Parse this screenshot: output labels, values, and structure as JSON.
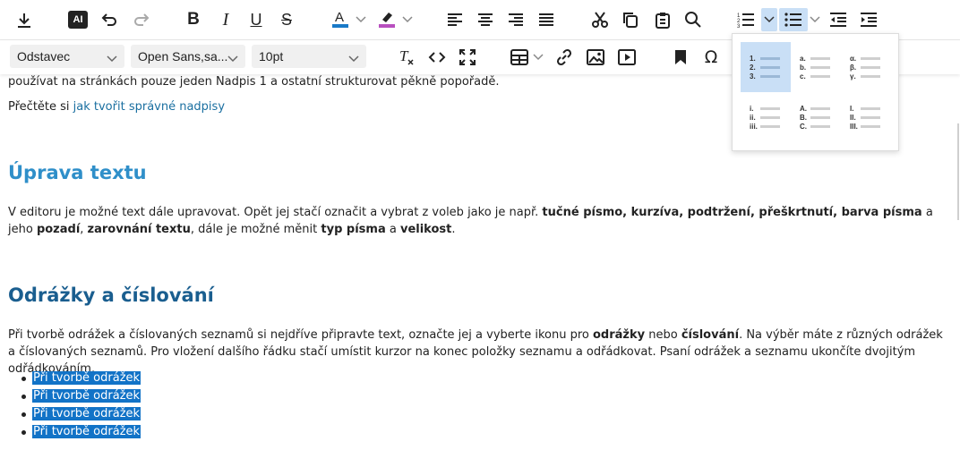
{
  "toolbar": {
    "ai_label": "AI"
  },
  "format_bar": {
    "block_format": "Odstavec",
    "font_family": "Open Sans,sa...",
    "font_size": "10pt"
  },
  "content": {
    "p_top": "používat na stránkách pouze jeden Nadpis 1 a ostatní strukturovat pěkně popořadě.",
    "read_prefix": "Přečtěte si ",
    "read_link": "jak tvořit správné nadpisy",
    "h_edit": "Úprava textu",
    "edit_p": {
      "t1": "V editoru je možné text dále upravovat. Opět jej stačí označit a vybrat z voleb jako je např. ",
      "b1": "tučné písmo, kurzíva, podtržení, přeškrtnutí, barva písma",
      "t2": " a jeho ",
      "b2": "pozadí",
      "t3": ", ",
      "b3": "zarovnání textu",
      "t4": ", dále je možné měnit ",
      "b4": "typ písma",
      "t5": " a ",
      "b5": "velikost",
      "t6": "."
    },
    "h_lists": "Odrážky a číslování",
    "lists_p": {
      "t1": "Při tvorbě odrážek a číslovaných seznamů si nejdříve připravte text, označte jej a vyberte ikonu pro ",
      "b1": "odrážky",
      "t2": " nebo ",
      "b2": "číslování",
      "t3": ". Na výběr máte z různých odrážek a číslovaných seznamů. Pro vložení dalšího řádku stačí umístit kurzor na konec položky seznamu a odřádkovat. Psaní odrážek a seznamu ukončíte dvojitým odřádkováním."
    },
    "bullets": [
      "Při tvorbě odrážek",
      "Při tvorbě odrážek",
      "Při tvorbě odrážek",
      "Při tvorbě odrážek"
    ]
  },
  "numbering_popup": {
    "options": [
      {
        "labels": [
          "1.",
          "2.",
          "3."
        ],
        "active": true
      },
      {
        "labels": [
          "a.",
          "b.",
          "c."
        ],
        "active": false
      },
      {
        "labels": [
          "α.",
          "β.",
          "γ."
        ],
        "active": false
      },
      {
        "labels": [
          "i.",
          "ii.",
          "iii."
        ],
        "active": false
      },
      {
        "labels": [
          "A.",
          "B.",
          "C."
        ],
        "active": false
      },
      {
        "labels": [
          "I.",
          "II.",
          "III."
        ],
        "active": false
      }
    ]
  },
  "colors": {
    "heading_edit": "#2f8fc9",
    "heading_lists": "#1a5e8f",
    "text_color_bar": "#1a7ac8",
    "highlight_bar": "#b84fbf",
    "selection": "#1273c7",
    "link": "#1a6fa0"
  }
}
